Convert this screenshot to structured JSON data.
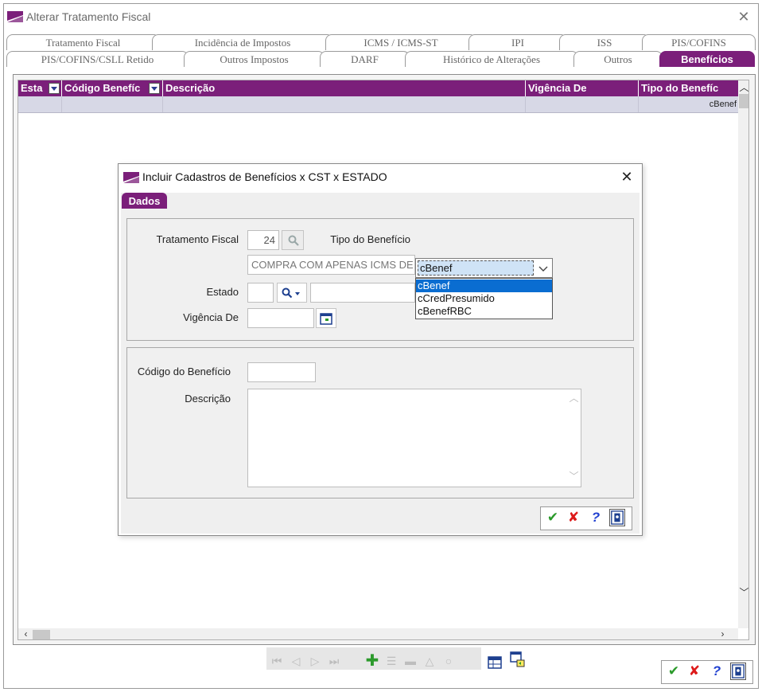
{
  "window": {
    "title": "Alterar Tratamento Fiscal",
    "close_glyph": "✕",
    "accent": "#7b1f7a"
  },
  "tabs_row1": [
    "Tratamento Fiscal",
    "Incidência de Impostos",
    "ICMS / ICMS-ST",
    "IPI",
    "ISS",
    "PIS/COFINS"
  ],
  "tabs_row2": [
    "PIS/COFINS/CSLL Retido",
    "Outros Impostos",
    "DARF",
    "Histórico de Alterações",
    "Outros",
    "Benefícios"
  ],
  "active_tab": "Benefícios",
  "grid": {
    "columns": [
      "Esta",
      "Código Benefíc",
      "Descrição",
      "Vigência De",
      "Tipo do Benefíc"
    ],
    "rows": [
      {
        "estado": "",
        "codigo": "",
        "descricao": "",
        "vigencia": "",
        "tipo": "cBenef"
      }
    ]
  },
  "dialog": {
    "title": "Incluir Cadastros de Benefícios  x CST x ESTADO",
    "close_glyph": "✕",
    "tab": "Dados",
    "fields": {
      "tratamento_fiscal_label": "Tratamento Fiscal",
      "tratamento_fiscal_value": "24",
      "tratamento_fiscal_desc": "COMPRA COM APENAS ICMS DE ST",
      "tipo_beneficio_label": "Tipo do Benefício",
      "tipo_beneficio_value": "cBenef",
      "tipo_beneficio_options": [
        "cBenef",
        "cCredPresumido",
        "cBenefRBC"
      ],
      "estado_label": "Estado",
      "estado_value": "",
      "vigencia_label": "Vigência De",
      "vigencia_value": "",
      "codigo_label": "Código do Benefício",
      "codigo_value": "",
      "descricao_label": "Descrição",
      "descricao_value": ""
    }
  },
  "icons": [
    "app-logo-icon",
    "search-icon",
    "calendar-icon",
    "first-icon",
    "prev-icon",
    "next-icon",
    "last-icon",
    "add-icon",
    "edit-icon",
    "delete-icon",
    "save-icon",
    "filter-icon",
    "grid-icon",
    "export-icon",
    "ok-icon",
    "cancel-icon",
    "help-icon",
    "exit-icon"
  ]
}
